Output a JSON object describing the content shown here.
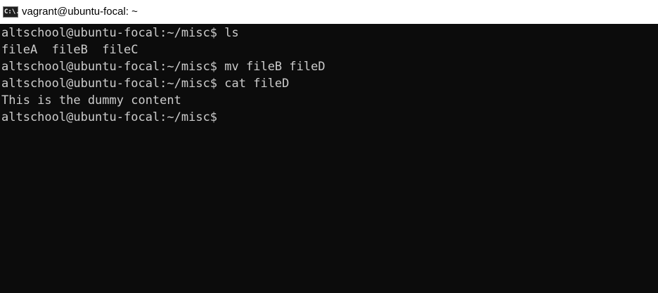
{
  "window": {
    "title": "vagrant@ubuntu-focal: ~",
    "icon": {
      "name": "command-prompt-icon",
      "label": "C:\\."
    }
  },
  "terminal": {
    "lines": [
      "altschool@ubuntu-focal:~/misc$ ls",
      "fileA  fileB  fileC",
      "altschool@ubuntu-focal:~/misc$ mv fileB fileD",
      "altschool@ubuntu-focal:~/misc$ cat fileD",
      "This is the dummy content",
      "altschool@ubuntu-focal:~/misc$ "
    ]
  },
  "colors": {
    "terminal_background": "#0c0c0c",
    "terminal_foreground": "#cccccc",
    "titlebar_background": "#ffffff",
    "title_text": "#000000"
  }
}
